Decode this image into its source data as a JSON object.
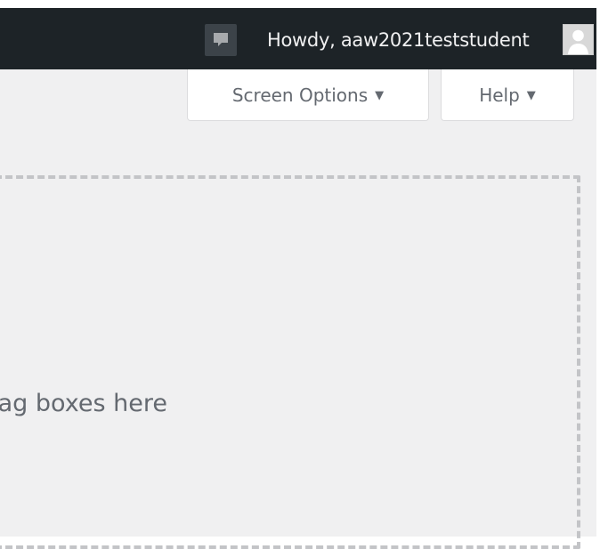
{
  "admin_bar": {
    "greeting": "Howdy, aaw2021teststudent",
    "comment_icon": "comment-bubble-icon",
    "avatar_icon": "user-avatar-icon"
  },
  "screen_meta": {
    "screen_options_label": "Screen Options",
    "help_label": "Help",
    "dropdown_arrow": "▼"
  },
  "dashboard": {
    "drop_zone_text": "Drag boxes here"
  },
  "colors": {
    "admin_bar_bg": "#1d2327",
    "page_bg": "#f0f0f1",
    "text_muted": "#646970"
  }
}
